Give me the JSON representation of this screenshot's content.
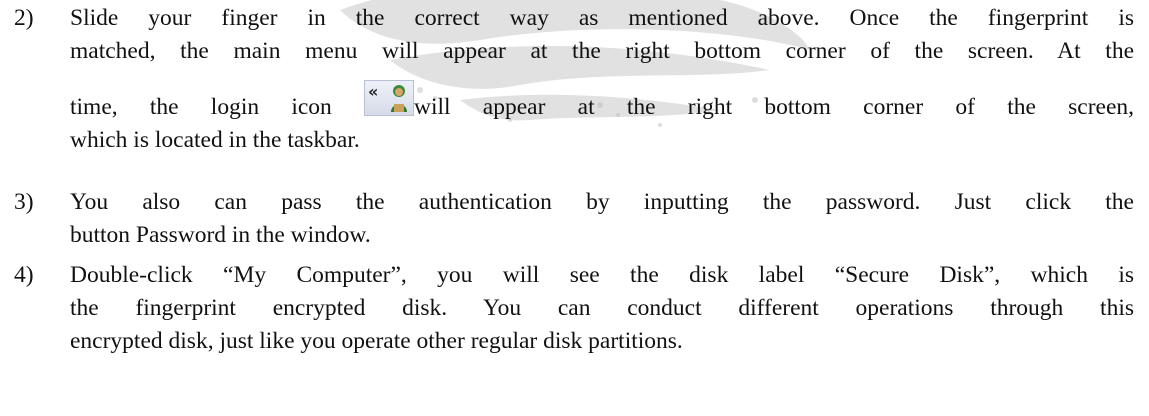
{
  "items": [
    {
      "number": "2)",
      "lines": [
        "Slide your finger in the correct way as mentioned above. Once the fingerprint is",
        "matched, the main menu will appear at the right bottom corner of the screen. At the"
      ],
      "icon_line_before": "time, the login icon",
      "icon_line_after": "will appear at the right bottom corner of the screen,",
      "last_line": "which is located in the taskbar."
    },
    {
      "number": "3)",
      "lines": [
        "You also can pass the authentication by inputting the password. Just click the",
        "button Password in the window."
      ]
    },
    {
      "number": "4)",
      "lines": [
        "Double-click “My Computer”, you will see the disk label “Secure Disk”, which is",
        "the fingerprint encrypted disk. You can conduct different operations through this",
        "encrypted disk, just like you operate other regular disk partitions."
      ]
    }
  ],
  "icons": {
    "login_icon": "login-icon",
    "login_icon_arrows": "«"
  }
}
